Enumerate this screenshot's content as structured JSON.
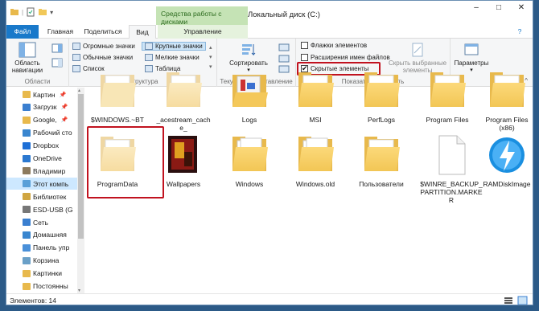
{
  "window": {
    "title": "Локальный диск (C:)",
    "context_tab_title": "Средства работы с дисками"
  },
  "tabs": {
    "file": "Файл",
    "home": "Главная",
    "share": "Поделиться",
    "view": "Вид",
    "manage": "Управление"
  },
  "ribbon": {
    "panes": {
      "nav_pane_line1": "Область",
      "nav_pane_line2": "навигации",
      "label": "Области"
    },
    "structure": {
      "label": "Структура",
      "items": {
        "huge": "Огромные значки",
        "large": "Крупные значки",
        "normal": "Обычные значки",
        "small": "Мелкие значки",
        "list": "Список",
        "table": "Таблица"
      }
    },
    "current_view": {
      "sort": "Сортировать",
      "label": "Текущее представление"
    },
    "show_hide": {
      "checkbox_items": "Флажки элементов",
      "extensions": "Расширения имен файлов",
      "hidden": "Скрытые элементы",
      "hide_selected_line1": "Скрыть выбранные",
      "hide_selected_line2": "элементы",
      "label": "Показать или скрыть"
    },
    "options": {
      "label": "Параметры"
    }
  },
  "nav": [
    {
      "label": "Картин",
      "pin": true,
      "color": "#e8b94c"
    },
    {
      "label": "Загрузк",
      "pin": true,
      "color": "#3a7fd0"
    },
    {
      "label": "Google,",
      "pin": true,
      "color": "#e8b94c"
    },
    {
      "label": "Рабочий сто",
      "pin": false,
      "color": "#3a86cf"
    },
    {
      "label": "Dropbox",
      "pin": false,
      "color": "#1e6fd6"
    },
    {
      "label": "OneDrive",
      "pin": false,
      "color": "#2b78d0"
    },
    {
      "label": "Владимир",
      "pin": false,
      "color": "#8c7a5e"
    },
    {
      "label": "Этот компь",
      "pin": false,
      "color": "#5aa0d8"
    },
    {
      "label": "Библиотек",
      "pin": false,
      "color": "#d0a540"
    },
    {
      "label": "ESD-USB (G",
      "pin": false,
      "color": "#777777"
    },
    {
      "label": "Сеть",
      "pin": false,
      "color": "#3a7fd0"
    },
    {
      "label": "Домашняя",
      "pin": false,
      "color": "#3a86cf"
    },
    {
      "label": "Панель упр",
      "pin": false,
      "color": "#4a90d9"
    },
    {
      "label": "Корзина",
      "pin": false,
      "color": "#6aa0c8"
    },
    {
      "label": "Картинки",
      "pin": false,
      "color": "#e8b94c"
    },
    {
      "label": "Постоянны",
      "pin": false,
      "color": "#e8b94c"
    }
  ],
  "files_row1": [
    {
      "name": "$WINDOWS.~BT"
    },
    {
      "name": "_acestream_cache_"
    },
    {
      "name": "Logs"
    },
    {
      "name": "MSI"
    },
    {
      "name": "PerfLogs"
    },
    {
      "name": "Program Files"
    },
    {
      "name": "Program Files (x86)"
    }
  ],
  "files_row2": [
    {
      "name": "ProgramData",
      "kind": "folder-light"
    },
    {
      "name": "Wallpapers",
      "kind": "image"
    },
    {
      "name": "Windows",
      "kind": "folder-docs"
    },
    {
      "name": "Windows.old",
      "kind": "folder-docs"
    },
    {
      "name": "Пользователи",
      "kind": "folder"
    },
    {
      "name": "$WINRE_BACKUP_PARTITION.MARKER",
      "kind": "file"
    },
    {
      "name": "RAMDiskImage",
      "kind": "app"
    }
  ],
  "status": {
    "count_text": "Элементов: 14"
  },
  "colors": {
    "accent": "#1979ca",
    "highlight_box": "#c1121f",
    "context_tab": "#c5e3b5"
  }
}
